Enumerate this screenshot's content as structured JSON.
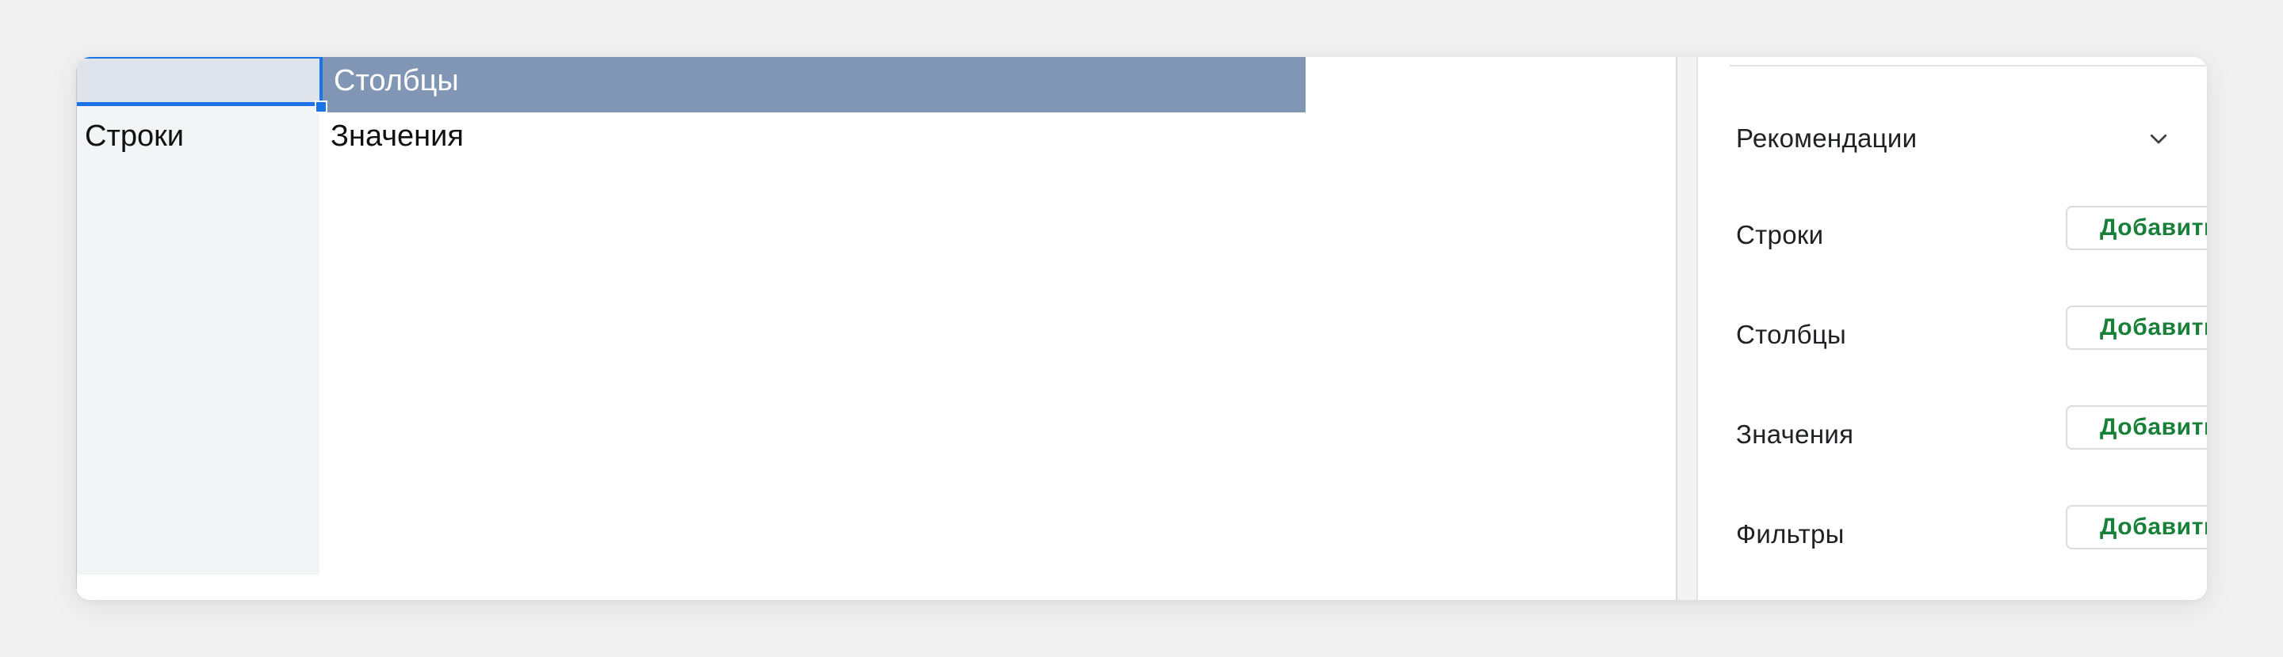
{
  "sheet": {
    "column_header": "Столбцы",
    "rows_label": "Строки",
    "values_label": "Значения"
  },
  "panel": {
    "recommendations_label": "Рекомендации",
    "fields": [
      {
        "label": "Строки",
        "button": "Добавить"
      },
      {
        "label": "Столбцы",
        "button": "Добавить"
      },
      {
        "label": "Значения",
        "button": "Добавить"
      },
      {
        "label": "Фильтры",
        "button": "Добавить"
      }
    ]
  },
  "icons": {
    "recommendations_toggle": "chevron-down-icon"
  },
  "colors": {
    "column_header_bg": "#8195b5",
    "selection": "#1a73e8",
    "add_button_text": "#188038"
  }
}
